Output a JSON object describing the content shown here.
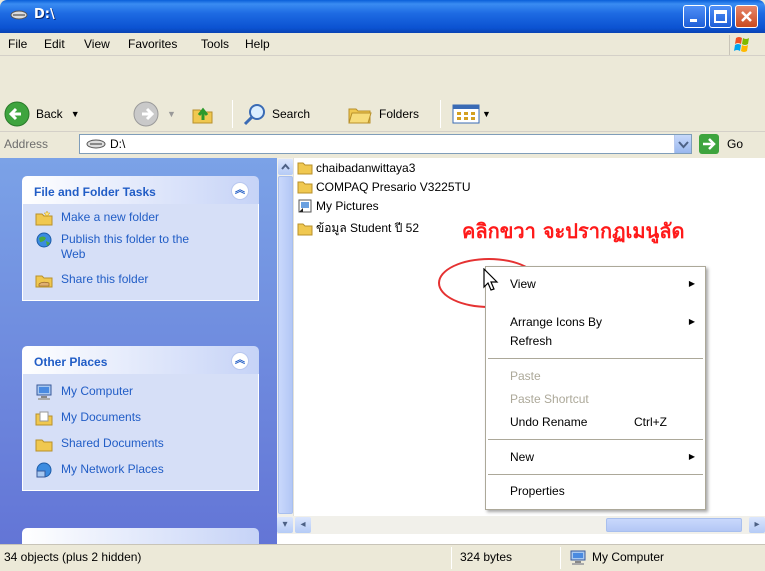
{
  "window": {
    "title": "D:\\"
  },
  "menu": {
    "items": [
      "File",
      "Edit",
      "View",
      "Favorites",
      "Tools",
      "Help"
    ]
  },
  "toolbar": {
    "back_label": "Back",
    "search_label": "Search",
    "folders_label": "Folders"
  },
  "address": {
    "label": "Address",
    "value": "D:\\",
    "go_label": "Go"
  },
  "tasks_panel": {
    "title": "File and Folder Tasks",
    "items": [
      "Make a new folder",
      "Publish this folder to the Web",
      "Share this folder"
    ]
  },
  "other_places": {
    "title": "Other Places",
    "items": [
      "My Computer",
      "My Documents",
      "Shared Documents",
      "My Network Places"
    ]
  },
  "files": [
    "chaibadanwittaya3",
    "COMPAQ Presario V3225TU",
    "My Pictures",
    "ข้อมูล Student ปี 52"
  ],
  "annotation": "คลิกขวา จะปรากฏเมนูลัด",
  "context_menu": {
    "view": "View",
    "arrange": "Arrange Icons By",
    "refresh": "Refresh",
    "paste": "Paste",
    "paste_shortcut": "Paste Shortcut",
    "undo": "Undo Rename",
    "undo_shortcut": "Ctrl+Z",
    "new": "New",
    "properties": "Properties"
  },
  "status": {
    "objects": "34 objects (plus 2 hidden)",
    "size": "324 bytes",
    "location": "My Computer"
  },
  "colors": {
    "title_blue": "#0b52d1",
    "panel_link": "#215dc6",
    "annotation_red": "#ff1a1a"
  }
}
